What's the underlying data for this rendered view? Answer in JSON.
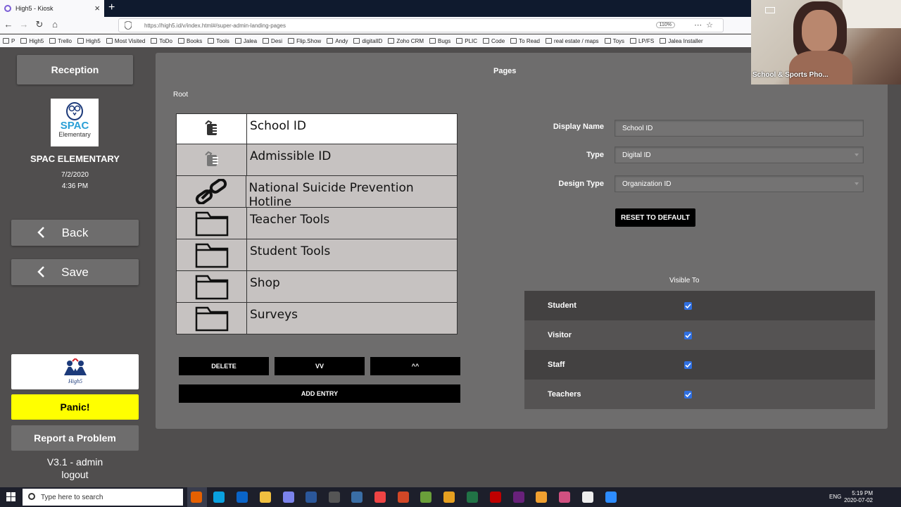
{
  "browser": {
    "tab_title": "High5 - Kiosk",
    "url": "https://high5.id/v/index.html#/super-admin-landing-pages",
    "zoom": "110%",
    "bookmarks": [
      "P",
      "High5",
      "Trello",
      "High5",
      "Most Visited",
      "ToDo",
      "Books",
      "Tools",
      "Jalea",
      "Desi",
      "Flip.Show",
      "Andy",
      "digitalID",
      "Zoho CRM",
      "Bugs",
      "PLIC",
      "Code",
      "To Read",
      "real estate / maps",
      "Toys",
      "LP/FS",
      "Jalea Installer"
    ]
  },
  "sidebar": {
    "reception_label": "Reception",
    "logo_text": "SPAC",
    "logo_sub": "Elementary",
    "school_name": "SPAC ELEMENTARY",
    "date": "7/2/2020",
    "time": "4:36 PM",
    "back_label": "Back",
    "save_label": "Save",
    "high5_logo": "High5",
    "panic_label": "Panic!",
    "report_label": "Report a Problem",
    "version": "V3.1   - admin",
    "logout_label": "logout"
  },
  "main": {
    "title": "Pages",
    "breadcrumb": "Root",
    "entries": [
      {
        "label": "School ID",
        "icon": "id-badge-icon",
        "selected": true
      },
      {
        "label": "Admissible ID",
        "icon": "id-badge-icon",
        "selected": false
      },
      {
        "label": "National Suicide Prevention Hotline",
        "icon": "link-icon",
        "selected": false
      },
      {
        "label": "Teacher Tools",
        "icon": "folder-icon",
        "selected": false
      },
      {
        "label": "Student Tools",
        "icon": "folder-icon",
        "selected": false
      },
      {
        "label": "Shop",
        "icon": "folder-icon",
        "selected": false
      },
      {
        "label": "Surveys",
        "icon": "folder-icon",
        "selected": false
      }
    ],
    "delete_label": "DELETE",
    "move_down_label": "VV",
    "move_up_label": "^^",
    "add_entry_label": "ADD ENTRY",
    "display_name_label": "Display Name",
    "display_name_value": "School ID",
    "type_label": "Type",
    "type_value": "Digital ID",
    "design_type_label": "Design Type",
    "design_type_value": "Organization ID",
    "reset_label": "RESET TO DEFAULT",
    "visible_to_label": "Visible To",
    "visible_to": [
      {
        "label": "Student",
        "checked": true
      },
      {
        "label": "Visitor",
        "checked": true
      },
      {
        "label": "Staff",
        "checked": true
      },
      {
        "label": "Teachers",
        "checked": true
      }
    ]
  },
  "webcam": {
    "label": "School & Sports Pho..."
  },
  "taskbar": {
    "search_placeholder": "Type here to search",
    "lang": "ENG",
    "time": "5:19 PM",
    "date": "2020-07-02"
  },
  "colors": {
    "panel": "#6e6d6d",
    "background": "#504e4e",
    "panic": "#ffff00",
    "checkbox": "#2f6fe0"
  }
}
